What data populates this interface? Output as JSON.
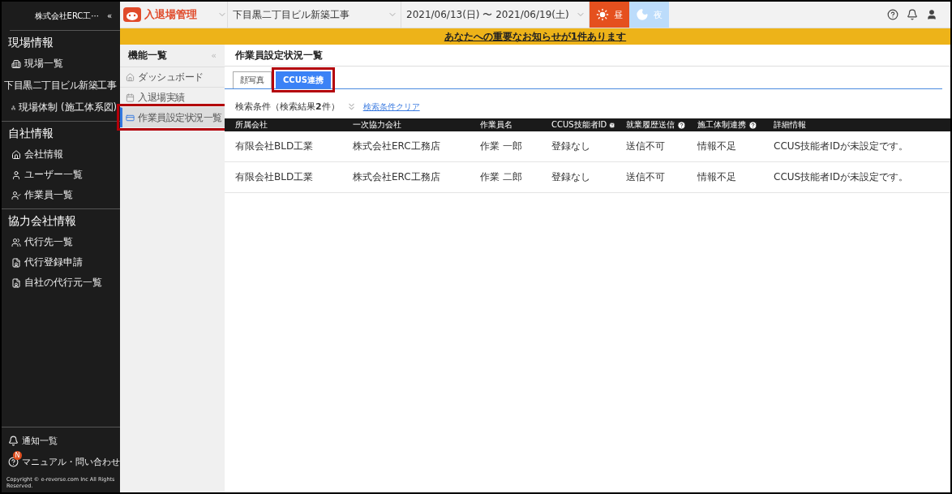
{
  "sidebar": {
    "company": "株式会社ERC工···",
    "collapse": "«",
    "sections": [
      {
        "heading": "現場情報",
        "items": [
          {
            "kind": "link",
            "label": "現場一覧"
          },
          {
            "kind": "site",
            "label": "下目黒二丁目ビル新築工事"
          },
          {
            "kind": "link",
            "label": "現場体制 (施工体系図)"
          }
        ]
      },
      {
        "heading": "自社情報",
        "items": [
          {
            "kind": "link",
            "label": "会社情報"
          },
          {
            "kind": "link",
            "label": "ユーザー一覧"
          },
          {
            "kind": "link",
            "label": "作業員一覧"
          }
        ]
      },
      {
        "heading": "協力会社情報",
        "items": [
          {
            "kind": "link",
            "label": "代行先一覧"
          },
          {
            "kind": "link",
            "label": "代行登録申請"
          },
          {
            "kind": "link",
            "label": "自社の代行元一覧"
          }
        ]
      }
    ],
    "footer": [
      {
        "label": "通知一覧"
      },
      {
        "label": "マニュアル・問い合わせ",
        "badge": "N"
      }
    ],
    "copyright": "Copyright © e-reverse.com Inc All Rights Reserved."
  },
  "topbar": {
    "app": "入退場管理",
    "site": "下目黒二丁目ビル新築工事",
    "dates": "2021/06/13(日) 〜 2021/06/19(土)",
    "shifts": [
      {
        "kind": "day",
        "label": "昼",
        "selected": true
      },
      {
        "kind": "night",
        "label": "夜",
        "selected": false
      }
    ]
  },
  "banner": "あなたへの重要なお知らせが1件あります",
  "functions": {
    "title": "機能一覧",
    "collapse": "«",
    "items": [
      {
        "label": "ダッシュボード",
        "selected": false
      },
      {
        "label": "入退場実績",
        "selected": false
      },
      {
        "label": "作業員設定状況一覧",
        "selected": true
      }
    ]
  },
  "main": {
    "title": "作業員設定状況一覧",
    "tabs": [
      {
        "label": "顔写真",
        "selected": false
      },
      {
        "label": "CCUS連携",
        "selected": true
      }
    ],
    "search": {
      "label": "検索条件（検索結果**2**件）",
      "clear": "検索条件クリア"
    },
    "table": {
      "columns": [
        {
          "label": "所属会社",
          "help": false
        },
        {
          "label": "一次協力会社",
          "help": false
        },
        {
          "label": "作業員名",
          "help": false
        },
        {
          "label": "CCUS技能者ID",
          "help": true
        },
        {
          "label": "就業履歴送信",
          "help": true
        },
        {
          "label": "施工体制連携",
          "help": true
        },
        {
          "label": "詳細情報",
          "help": false
        }
      ],
      "rows": [
        [
          "有限会社BLD工業",
          "株式会社ERC工務店",
          "作業 一郎",
          "登録なし",
          "送信不可",
          "情報不足",
          "CCUS技能者IDが未設定です。"
        ],
        [
          "有限会社BLD工業",
          "株式会社ERC工務店",
          "作業 二郎",
          "登録なし",
          "送信不可",
          "情報不足",
          "CCUS技能者IDが未設定です。"
        ]
      ]
    }
  }
}
